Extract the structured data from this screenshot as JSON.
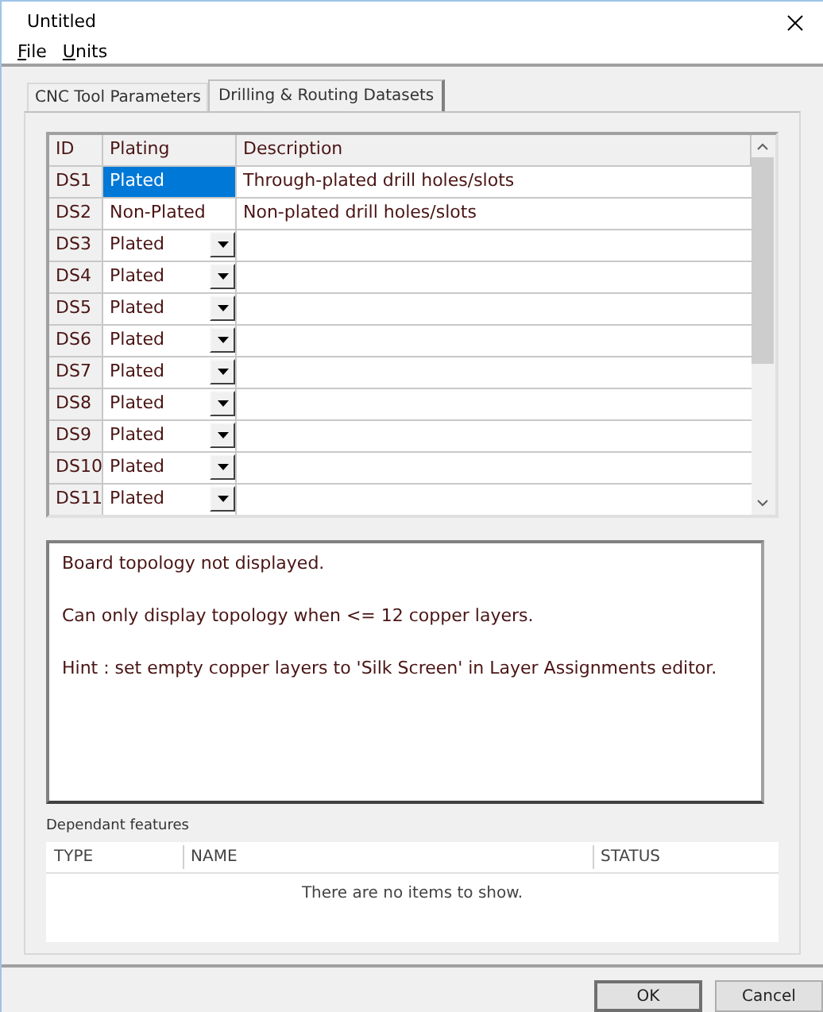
{
  "window": {
    "title": "Untitled"
  },
  "menu": [
    "File",
    "Units"
  ],
  "tabs": [
    {
      "label": "CNC Tool Parameters",
      "selected": false
    },
    {
      "label": "Drilling & Routing Datasets",
      "selected": true
    }
  ],
  "grid": {
    "columns": [
      "ID",
      "Plating",
      "Description"
    ],
    "rows": [
      {
        "id": "DS1",
        "plating": "Plated",
        "description": "Through-plated drill holes/slots",
        "dropdown": false,
        "selected": true
      },
      {
        "id": "DS2",
        "plating": "Non-Plated",
        "description": "Non-plated drill holes/slots",
        "dropdown": false,
        "selected": false
      },
      {
        "id": "DS3",
        "plating": "Plated",
        "dropdown": true,
        "selected": false
      },
      {
        "id": "DS4",
        "plating": "Plated",
        "dropdown": true,
        "selected": false
      },
      {
        "id": "DS5",
        "plating": "Plated",
        "dropdown": true,
        "selected": false
      },
      {
        "id": "DS6",
        "plating": "Plated",
        "dropdown": true,
        "selected": false
      },
      {
        "id": "DS7",
        "plating": "Plated",
        "dropdown": true,
        "selected": false
      },
      {
        "id": "DS8",
        "plating": "Plated",
        "dropdown": true,
        "selected": false
      },
      {
        "id": "DS9",
        "plating": "Plated",
        "dropdown": true,
        "selected": false
      },
      {
        "id": "DS10",
        "plating": "Plated",
        "dropdown": true,
        "selected": false
      },
      {
        "id": "DS11",
        "plating": "Plated",
        "dropdown": true,
        "selected": false
      }
    ]
  },
  "message": [
    "Board topology not displayed.",
    "Can only display topology when <= 12 copper layers.",
    "Hint : set empty copper layers to 'Silk Screen' in Layer Assignments editor."
  ],
  "dependant_features": {
    "label": "Dependant features",
    "columns": [
      "TYPE",
      "NAME",
      "STATUS"
    ],
    "empty_text": "There are no items to show."
  },
  "buttons": [
    "OK",
    "Cancel"
  ]
}
